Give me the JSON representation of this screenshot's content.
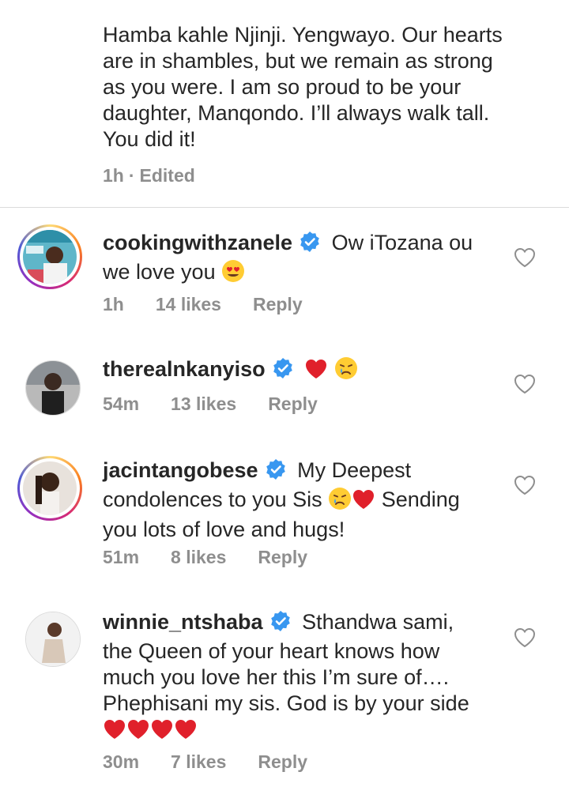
{
  "caption": {
    "text": "Hamba kahle Njinji. Yengwayo. Our hearts\nare in shambles, but we remain as strong\nas you were. I am so proud to be your\ndaughter, Manqondo. I’ll always walk tall.\nYou did it!",
    "time": "1h",
    "separator": "·",
    "edited": "Edited"
  },
  "comments": [
    {
      "username": "cookingwithzanele",
      "text_a": "Ow iTozana ou",
      "text_b": "we love you",
      "emojis": [
        "heart-eyes"
      ],
      "time": "1h",
      "likes": "14 likes",
      "reply": "Reply",
      "story_ring": true
    },
    {
      "username": "therealnkanyiso",
      "text_a": "",
      "text_b": "",
      "emojis": [
        "red-heart",
        "crying-face"
      ],
      "time": "54m",
      "likes": "13 likes",
      "reply": "Reply",
      "story_ring": false
    },
    {
      "username": "jacintangobese",
      "text_a": "My Deepest",
      "text_b": "condolences to you Sis",
      "text_c": "Sending",
      "text_d": "you lots of love and hugs!",
      "emojis": [
        "crying-face",
        "red-heart"
      ],
      "time": "51m",
      "likes": "8 likes",
      "reply": "Reply",
      "story_ring": true
    },
    {
      "username": "winnie_ntshaba",
      "text_a": "Sthandwa sami,",
      "text_b": "the Queen of your heart knows how",
      "text_c": "much you love her this I’m sure of….",
      "text_d": "Phephisani my sis. God is by your side",
      "emojis": [
        "red-heart",
        "red-heart",
        "red-heart",
        "red-heart"
      ],
      "time": "30m",
      "likes": "7 likes",
      "reply": "Reply",
      "story_ring": false
    }
  ],
  "colors": {
    "text": "#262626",
    "muted": "#8e8e8e",
    "verified_blue": "#3897f0",
    "heart_red": "#e0202b",
    "divider": "#dbdbdb"
  },
  "icons": {
    "verified": "verified-badge-icon",
    "like": "heart-outline-icon"
  }
}
